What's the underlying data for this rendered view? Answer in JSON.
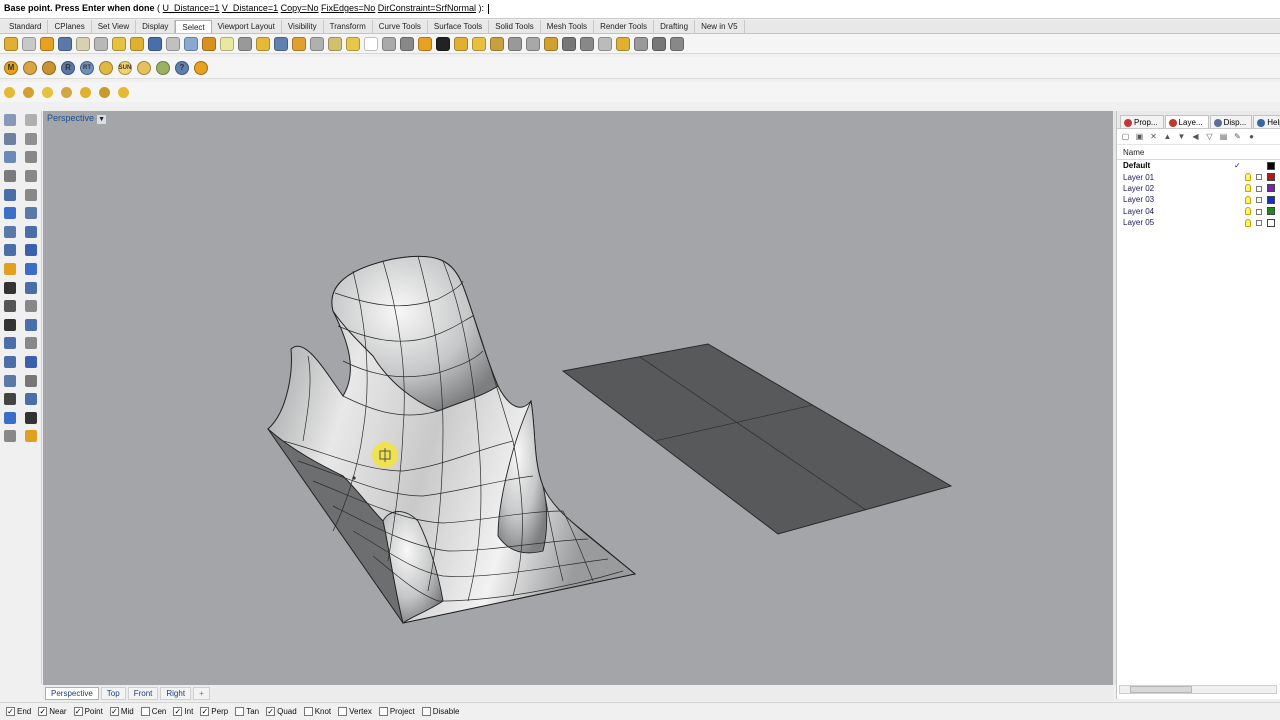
{
  "command_line": {
    "prompt": "Base point. Press Enter when done",
    "options_prefix": " ( ",
    "options": [
      "U_Distance=1",
      "V_Distance=1",
      "Copy=No",
      "FixEdges=No",
      "DirConstraint=SrfNormal"
    ],
    "suffix": " ): "
  },
  "toolbar_tabs": [
    "Standard",
    "CPlanes",
    "Set View",
    "Display",
    "Select",
    "Viewport Layout",
    "Visibility",
    "Transform",
    "Curve Tools",
    "Surface Tools",
    "Solid Tools",
    "Mesh Tools",
    "Render Tools",
    "Drafting",
    "New in V5"
  ],
  "active_toolbar_tab": "Select",
  "toolbar2_icons": [
    {
      "name": "materials-icon",
      "glyph": "M",
      "color": "#e8a21a"
    },
    {
      "name": "render-icon-2",
      "glyph": "",
      "color": "#d9a441"
    },
    {
      "name": "render-icon-3",
      "glyph": "",
      "color": "#c99330"
    },
    {
      "name": "raytrace-icon",
      "glyph": "R",
      "color": "#5a78a8"
    },
    {
      "name": "rendered-icon",
      "glyph": "RT",
      "color": "#6f8fbf"
    },
    {
      "name": "sun-icon",
      "glyph": "",
      "color": "#e0b840"
    },
    {
      "name": "sun-label-icon",
      "glyph": "SUN",
      "color": "#f4d26a"
    },
    {
      "name": "light-icon",
      "glyph": "",
      "color": "#e7c25a"
    },
    {
      "name": "environment-icon",
      "glyph": "",
      "color": "#9bb060"
    },
    {
      "name": "help-icon",
      "glyph": "?",
      "color": "#5f7fb0"
    },
    {
      "name": "settings-icon",
      "glyph": "",
      "color": "#e8a020"
    }
  ],
  "toolbar3_icons": [
    {
      "name": "sun-small-icon",
      "color": "#e6b838"
    },
    {
      "name": "spotlight-icon",
      "color": "#d4a030"
    },
    {
      "name": "point-light-icon",
      "color": "#e8c040"
    },
    {
      "name": "sphere-light-icon",
      "color": "#d0a840"
    },
    {
      "name": "directional-light-icon",
      "color": "#e0b030"
    },
    {
      "name": "linear-light-icon",
      "color": "#c89a28"
    },
    {
      "name": "rect-light-icon",
      "color": "#e6b838"
    }
  ],
  "viewport": {
    "label": "Perspective"
  },
  "panel": {
    "tabs": [
      {
        "label": "Prop...",
        "color": "#c03a3a",
        "active": false
      },
      {
        "label": "Laye...",
        "color": "#c0392b",
        "active": true
      },
      {
        "label": "Disp...",
        "color": "#5a6f9a",
        "active": false
      },
      {
        "label": "Help",
        "color": "#3366aa",
        "active": false
      }
    ],
    "column_name": "Name",
    "layers": [
      {
        "name": "Default",
        "current": true,
        "color": "#000000"
      },
      {
        "name": "Layer 01",
        "current": false,
        "color": "#b01818"
      },
      {
        "name": "Layer 02",
        "current": false,
        "color": "#7a22a8"
      },
      {
        "name": "Layer 03",
        "current": false,
        "color": "#1a2ec8"
      },
      {
        "name": "Layer 04",
        "current": false,
        "color": "#1a8a1a"
      },
      {
        "name": "Layer 05",
        "current": false,
        "color": "#ffffff"
      }
    ],
    "current_mark": "✓"
  },
  "viewport_tabs": [
    "Perspective",
    "Top",
    "Front",
    "Right"
  ],
  "viewport_tabs_active": "Perspective",
  "viewport_tabs_plus": "+",
  "osnaps": [
    {
      "label": "End",
      "checked": true
    },
    {
      "label": "Near",
      "checked": true
    },
    {
      "label": "Point",
      "checked": true
    },
    {
      "label": "Mid",
      "checked": true
    },
    {
      "label": "Cen",
      "checked": false
    },
    {
      "label": "Int",
      "checked": true
    },
    {
      "label": "Perp",
      "checked": true
    },
    {
      "label": "Tan",
      "checked": false
    },
    {
      "label": "Quad",
      "checked": true
    },
    {
      "label": "Knot",
      "checked": false
    },
    {
      "label": "Vertex",
      "checked": false
    },
    {
      "label": "Project",
      "checked": false
    },
    {
      "label": "Disable",
      "checked": false
    }
  ]
}
